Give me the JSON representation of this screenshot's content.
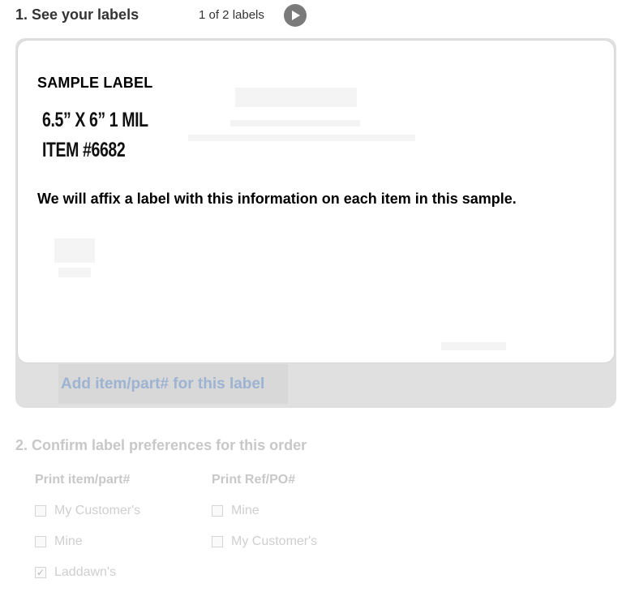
{
  "step1": {
    "title": "1. See your labels",
    "label_count": "1 of 2 labels",
    "next_icon": "play-circle-icon"
  },
  "label_card": {
    "sample_title": "SAMPLE LABEL",
    "spec_line1": "6.5” X 6” 1 MIL",
    "spec_line2": "ITEM #6682",
    "note": "We will affix a label with this information on each item in this sample."
  },
  "add_item_button": "Add item/part# for this label",
  "step2": {
    "title": "2. Confirm label preferences for this order",
    "columns": [
      {
        "heading": "Print item/part#",
        "options": [
          {
            "label": "My Customer's",
            "checked": false
          },
          {
            "label": "Mine",
            "checked": false
          },
          {
            "label": "Laddawn's",
            "checked": true
          }
        ]
      },
      {
        "heading": "Print Ref/PO#",
        "options": [
          {
            "label": "Mine",
            "checked": false
          },
          {
            "label": "My Customer's",
            "checked": false
          }
        ]
      }
    ]
  },
  "colors": {
    "panel_background": "#e0e0e0",
    "button_text": "#9db3d2",
    "disabled_text": "#c8c8c8"
  }
}
